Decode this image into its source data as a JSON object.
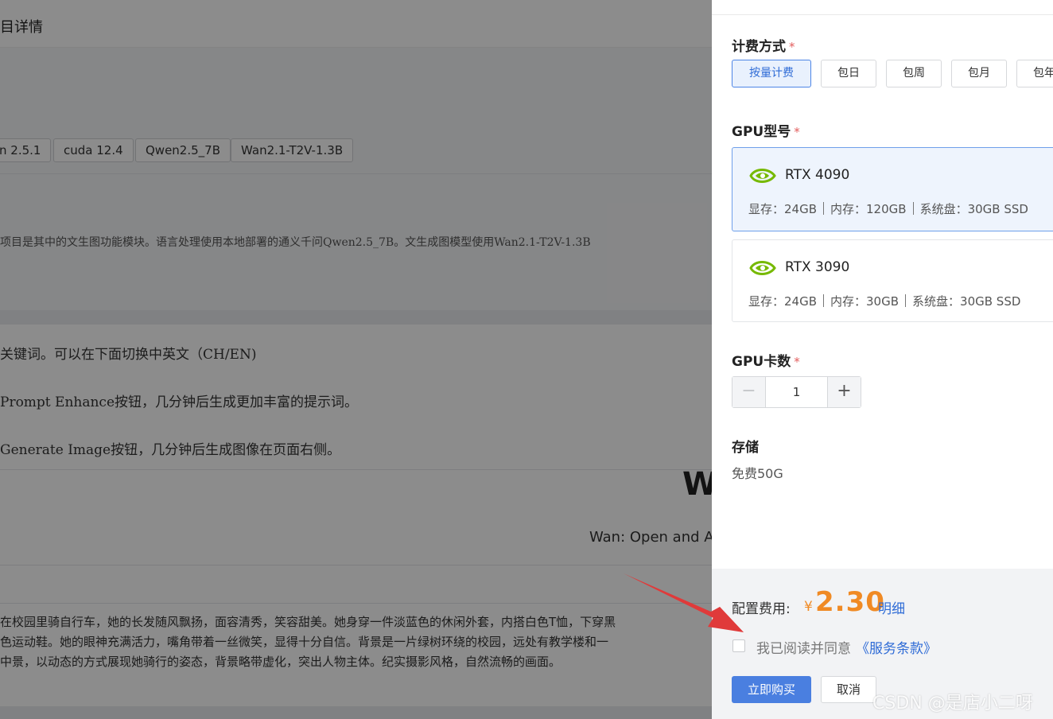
{
  "background_page": {
    "title": "目详情",
    "tags": [
      "n 2.5.1",
      "cuda 12.4",
      "Qwen2.5_7B",
      "Wan2.1-T2V-1.3B"
    ],
    "description": "项目是其中的文生图功能模块。语言处理使用本地部署的通义千问Qwen2.5_7B。文生成图模型使用Wan2.1-T2V-1.3B",
    "steps": [
      "关键词。可以在下面切换中英文（CH/EN)",
      "Prompt Enhance按钮，几分钟后生成更加丰富的提示词。",
      "Generate Image按钮，几分钟后生成图像在页面右侧。"
    ],
    "app_title_partial": "Wa",
    "app_subtitle_partial": "Wan: Open and Ad",
    "prompt_lines": [
      "在校园里骑自行车，她的长发随风飘扬，面容清秀，笑容甜美。她身穿一件淡蓝色的休闲外套，内搭白色T恤，下穿黑",
      "色运动鞋。她的眼神充满活力，嘴角带着一丝微笑，显得十分自信。背景是一片绿树环绕的校园，远处有教学楼和一",
      "中景，以动态的方式展现她骑行的姿态，背景略带虚化，突出人物主体。纪实摄影风格，自然流畅的画面。"
    ]
  },
  "drawer": {
    "billing": {
      "label": "计费方式",
      "required_mark": "*",
      "options": [
        "按量计费",
        "包日",
        "包周",
        "包月",
        "包年"
      ],
      "selected": "按量计费"
    },
    "gpu_model": {
      "label": "GPU型号",
      "required_mark": "*",
      "cards": [
        {
          "name": "RTX 4090",
          "vram": "显存：24GB",
          "ram": "内存：120GB",
          "disk": "系统盘：30GB SSD",
          "selected": true
        },
        {
          "name": "RTX 3090",
          "vram": "显存：24GB",
          "ram": "内存：30GB",
          "disk": "系统盘：30GB SSD",
          "selected": false
        }
      ]
    },
    "gpu_count": {
      "label": "GPU卡数",
      "required_mark": "*",
      "value": "1",
      "minus": "−",
      "plus": "+"
    },
    "storage": {
      "label": "存储",
      "value": "免费50G"
    },
    "footer": {
      "fee_label": "配置费用:",
      "currency": "¥",
      "amount": "2.30",
      "detail_link": "明细",
      "agree_text": "我已阅读并同意",
      "terms_link": "《服务条款》",
      "buy_button": "立即购买",
      "cancel_button": "取消"
    }
  },
  "watermark": "CSDN @是店小二呀",
  "colors": {
    "primary": "#4a7fe0",
    "price": "#f08a24",
    "nvidia_green": "#76b900",
    "annotation_arrow": "#e03a3a"
  }
}
